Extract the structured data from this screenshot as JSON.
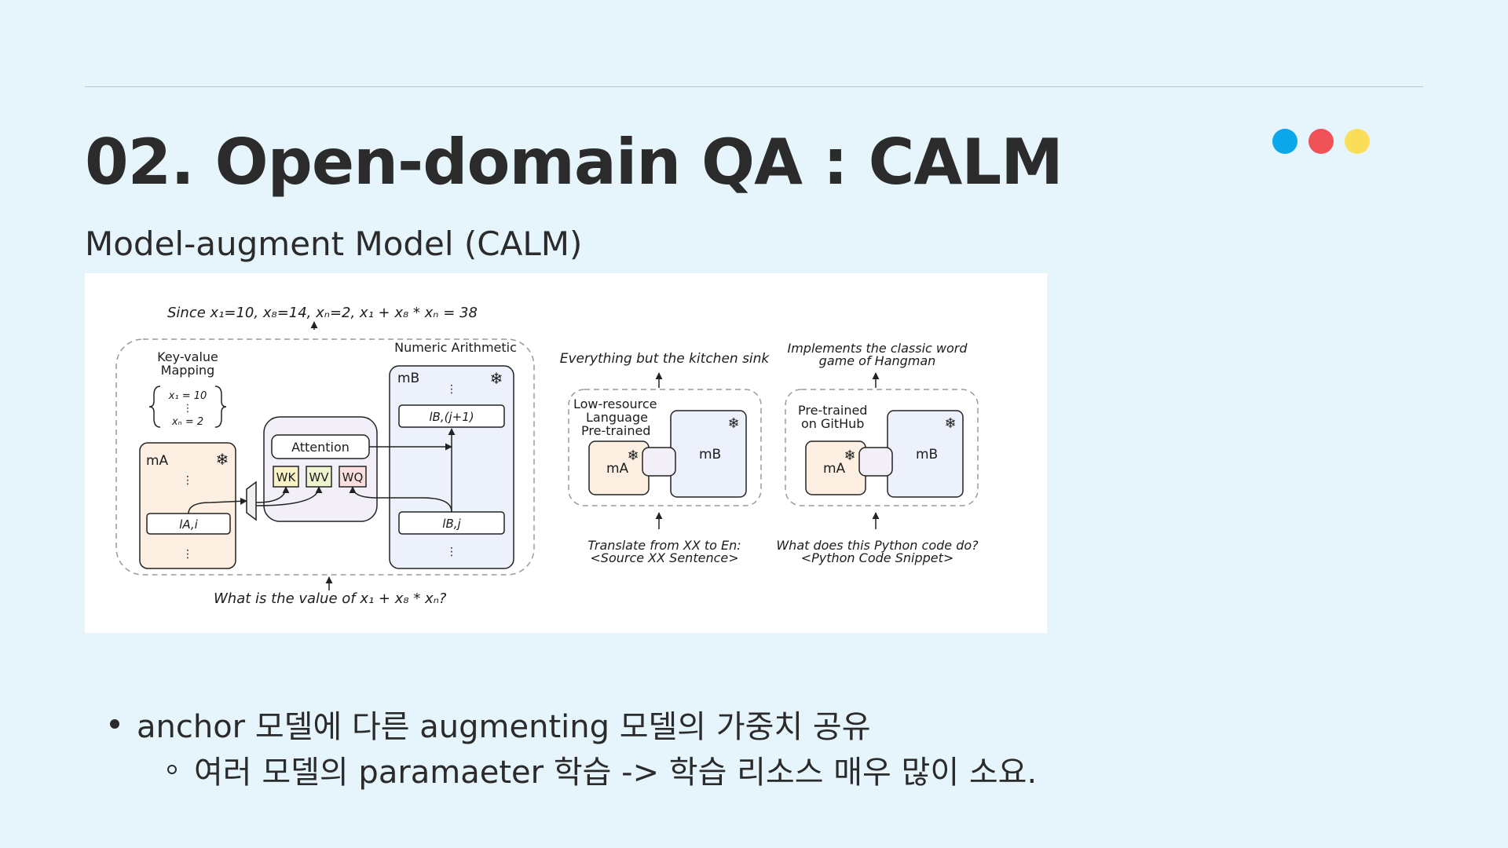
{
  "slide": {
    "title": "02. Open-domain QA : CALM",
    "subtitle": "Model-augment Model (CALM)"
  },
  "colors": {
    "dot1": "#0aa7ea",
    "dot2": "#ef5358",
    "dot3": "#fadd58",
    "model_a": "#fdf0e3",
    "model_b": "#edf1fb",
    "attention": "#f3eff8"
  },
  "figure": {
    "top_equation": "Since x₁=10, x₈=14, xₙ=2, x₁ + x₈ * xₙ = 38",
    "keyvalue_label_1": "Key-value",
    "keyvalue_label_2": "Mapping",
    "kv_first": "x₁ = 10",
    "kv_last": "xₙ = 2",
    "numeric_label": "Numeric Arithmetic",
    "ma": "mA",
    "mb": "mB",
    "vdots": "⋮",
    "la_i": "lA,i",
    "lb_j1": "lB,(j+1)",
    "lb_j": "lB,j",
    "attention": "Attention",
    "wk": "WK",
    "wv": "WV",
    "wq": "WQ",
    "bottom_question": "What is the value of x₁ + x₈ * xₙ?",
    "snowflake_icon": "❄",
    "panel2": {
      "top_text": "Everything but the kitchen sink",
      "label_1": "Low-resource",
      "label_2": "Language",
      "label_3": "Pre-trained",
      "ma": "mA",
      "mb": "mB",
      "bottom_1": "Translate from XX to En:",
      "bottom_2": "<Source XX Sentence>"
    },
    "panel3": {
      "top_1": "Implements the classic word",
      "top_2": "game of Hangman",
      "label_1": "Pre-trained",
      "label_2": "on GitHub",
      "ma": "mA",
      "mb": "mB",
      "bottom_1": "What does this Python code do?",
      "bottom_2": "<Python Code Snippet>"
    }
  },
  "bullets": {
    "level1": "anchor 모델에 다른 augmenting 모델의 가중치 공유",
    "level2": "여러 모델의 paramaeter 학습 -> 학습 리소스 매우 많이 소요."
  }
}
